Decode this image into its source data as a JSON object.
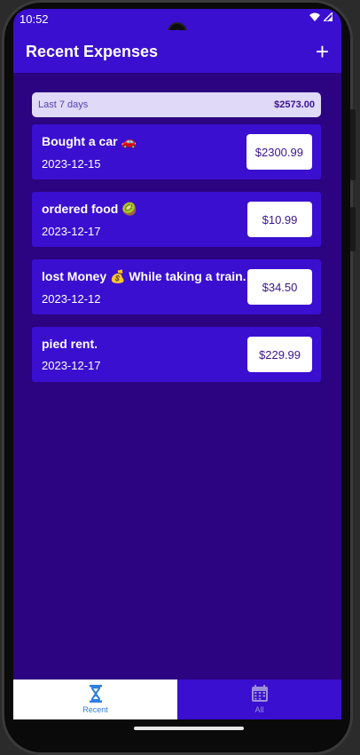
{
  "status_bar": {
    "time": "10:52"
  },
  "app_bar": {
    "title": "Recent Expenses",
    "add_label": "+"
  },
  "summary": {
    "period": "Last 7 days",
    "total": "$2573.00"
  },
  "expenses": [
    {
      "description": "Bought a car 🚗",
      "date": "2023-12-15",
      "amount": "$2300.99"
    },
    {
      "description": "ordered food 🥝",
      "date": "2023-12-17",
      "amount": "$10.99"
    },
    {
      "description": "lost Money 💰 While taking a train.",
      "date": "2023-12-12",
      "amount": "$34.50"
    },
    {
      "description": "pied rent.",
      "date": "2023-12-17",
      "amount": "$229.99"
    }
  ],
  "bottom_nav": {
    "recent_label": "Recent",
    "all_label": "All",
    "recent_icon": "hourglass-icon",
    "all_icon": "calendar-icon"
  },
  "colors": {
    "app_bar": "#3a0fd0",
    "background": "#2c0380",
    "active_tab": "#2d7fe0"
  }
}
